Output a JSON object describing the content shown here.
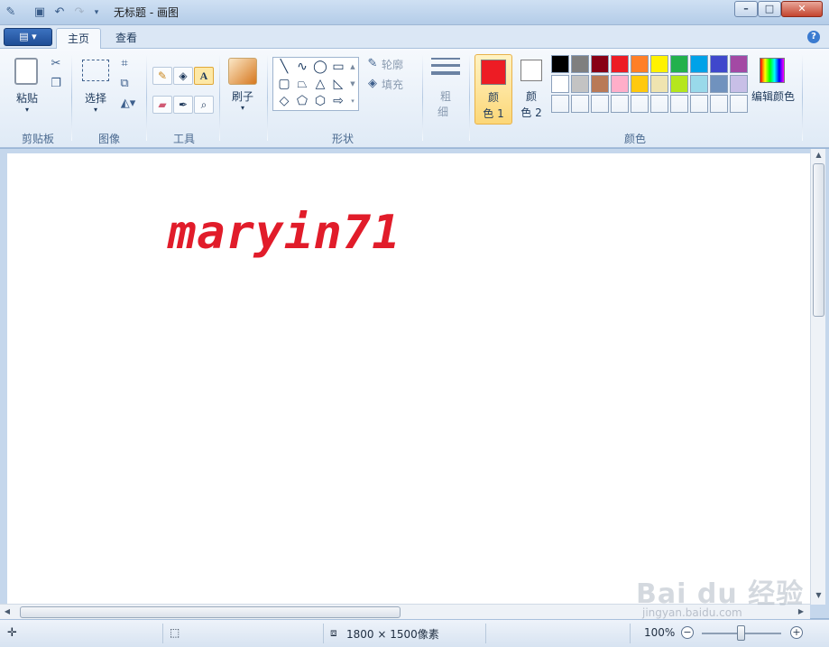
{
  "window": {
    "title": "无标题 - 画图",
    "minimize": "–",
    "maximize": "□",
    "close": "✕"
  },
  "tabs": {
    "app_menu": "▤ ▾",
    "home": "主页",
    "view": "查看",
    "help": "?"
  },
  "ribbon": {
    "clipboard": {
      "paste": "粘贴",
      "label": "剪贴板"
    },
    "image": {
      "select": "选择",
      "label": "图像"
    },
    "tools": {
      "label": "工具"
    },
    "brushes": {
      "label": "刷子"
    },
    "shapes": {
      "outline": "轮廓",
      "fill": "填充",
      "label": "形状"
    },
    "size": {
      "label_top": "粗",
      "label_bottom": "细"
    },
    "colors": {
      "color1_top": "颜",
      "color1_bottom": "色 1",
      "color2_top": "颜",
      "color2_bottom": "色 2",
      "edit": "编辑颜色",
      "label": "颜色",
      "color1_value": "#ed1c24",
      "color2_value": "#ffffff",
      "palette_row1": [
        "#000000",
        "#7f7f7f",
        "#880015",
        "#ed1c24",
        "#ff7f27",
        "#fff200",
        "#22b14c",
        "#00a2e8",
        "#3f48cc",
        "#a349a4"
      ],
      "palette_row2": [
        "#ffffff",
        "#c3c3c3",
        "#b97a57",
        "#ffaec9",
        "#ffc90e",
        "#efe4b0",
        "#b5e61d",
        "#99d9ea",
        "#7092be",
        "#c8bfe7"
      ],
      "palette_row3": [
        "#ffffff",
        "#ffffff",
        "#ffffff",
        "#ffffff",
        "#ffffff",
        "#ffffff",
        "#ffffff",
        "#ffffff",
        "#ffffff",
        "#ffffff"
      ]
    }
  },
  "canvas": {
    "text": "maryin71",
    "text_color": "#e11c2a"
  },
  "status": {
    "canvas_size": "1800 × 1500像素",
    "zoom": "100%"
  },
  "watermark": {
    "main": "Bai du 经验",
    "sub": "jingyan.baidu.com"
  }
}
